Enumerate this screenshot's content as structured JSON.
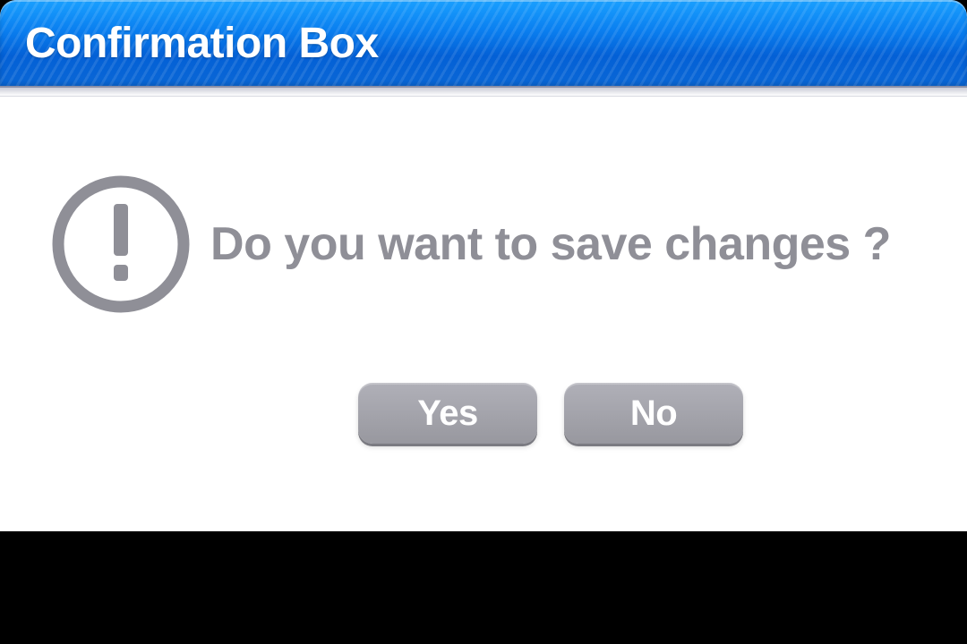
{
  "dialog": {
    "title": "Confirmation Box",
    "message": "Do you want to save changes ?",
    "icon": "exclamation",
    "buttons": {
      "yes": "Yes",
      "no": "No"
    }
  }
}
